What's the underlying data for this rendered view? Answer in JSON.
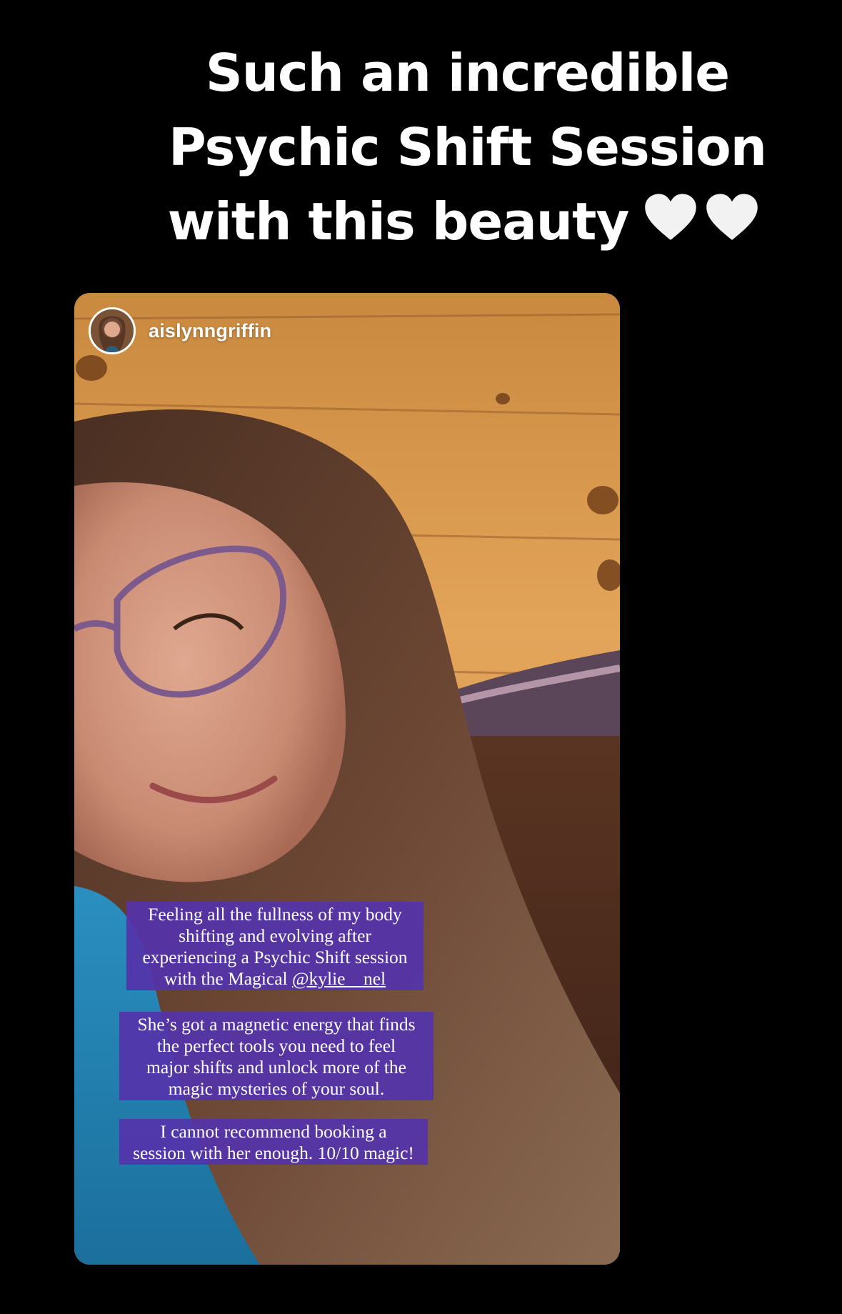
{
  "caption": {
    "line1": "Such an incredible",
    "line2": "Psychic Shift Session",
    "line3": "with this beauty",
    "emoji": [
      "white-heart-icon",
      "white-heart-icon"
    ]
  },
  "story": {
    "username": "aislynngriffin",
    "avatar_icon": "profile-photo-avatar",
    "text_boxes": [
      {
        "lines": [
          "Feeling all the fullness of my body",
          "shifting and evolving after",
          "experiencing a Psychic Shift session",
          "with the Magical "
        ],
        "mention": "@kylie__nel"
      },
      {
        "lines": [
          "She’s got a magnetic energy that finds",
          "the perfect tools you need to feel",
          "major shifts and unlock more of the",
          "magic mysteries of your soul."
        ]
      },
      {
        "lines": [
          "I cannot recommend booking a",
          "session with her enough. 10/10 magic!"
        ]
      }
    ]
  },
  "colors": {
    "background": "#000000",
    "caption_text": "#ffffff",
    "text_box_bg": "#5434aa",
    "heart": "#f2f2f2"
  }
}
